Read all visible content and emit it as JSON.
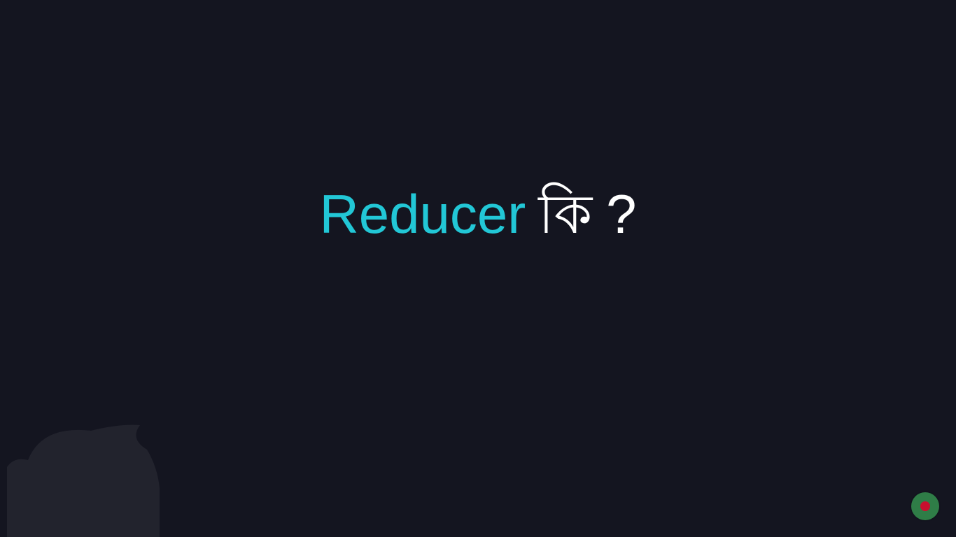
{
  "slide": {
    "title_english": "Reducer",
    "title_bengali": "কি",
    "title_punct": "?"
  },
  "colors": {
    "background": "#141520",
    "accent": "#22c7d6",
    "text": "#ffffff",
    "badge_green": "#2f7d47",
    "badge_red": "#c8102e"
  },
  "icons": {
    "watermark": "mascot-logo-icon",
    "badge": "bangladesh-flag-icon"
  }
}
